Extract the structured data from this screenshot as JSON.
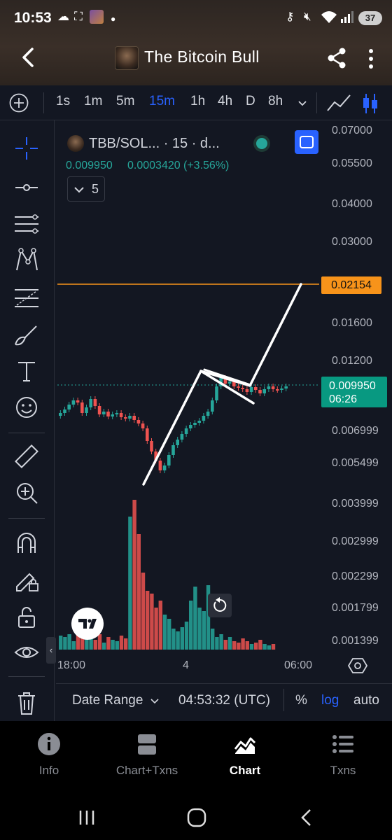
{
  "status": {
    "time": "10:53",
    "battery": "37"
  },
  "header": {
    "title": "The Bitcoin Bull"
  },
  "timeframes": {
    "items": [
      "1s",
      "1m",
      "5m",
      "15m",
      "1h",
      "4h",
      "D",
      "8h"
    ],
    "active": "15m"
  },
  "legend": {
    "symbol": "TBB/SOL... · 15 · d...",
    "price": "0.009950",
    "change": "0.0003420",
    "change_pct": "(+3.56%)",
    "indicators_count": "5"
  },
  "chart_data": {
    "type": "candlestick",
    "price_axis": [
      "0.07000",
      "0.05500",
      "0.04000",
      "0.03000",
      "0.02154",
      "0.01600",
      "0.01200",
      "0.009950",
      "0.006999",
      "0.005499",
      "0.003999",
      "0.002999",
      "0.002299",
      "0.001799",
      "0.001399"
    ],
    "scale": "log",
    "time_axis": [
      "18:00",
      "4",
      "06:00"
    ],
    "target_line_price": "0.02154",
    "last_price": "0.009950",
    "countdown": "06:26",
    "colors": {
      "up": "#26a69a",
      "down": "#ef5350",
      "target": "#f7931a",
      "drawing": "#ffffff"
    }
  },
  "price_badges": {
    "target": "0.02154",
    "last": "0.009950",
    "countdown": "06:26"
  },
  "bottom_bar": {
    "date_range": "Date Range",
    "time": "04:53:32 (UTC)",
    "percent": "%",
    "log": "log",
    "auto": "auto"
  },
  "tabs": [
    {
      "label": "Info",
      "icon": "info-icon"
    },
    {
      "label": "Chart+Txns",
      "icon": "split-icon"
    },
    {
      "label": "Chart",
      "icon": "chart-icon"
    },
    {
      "label": "Txns",
      "icon": "list-icon"
    }
  ],
  "active_tab": "Chart"
}
